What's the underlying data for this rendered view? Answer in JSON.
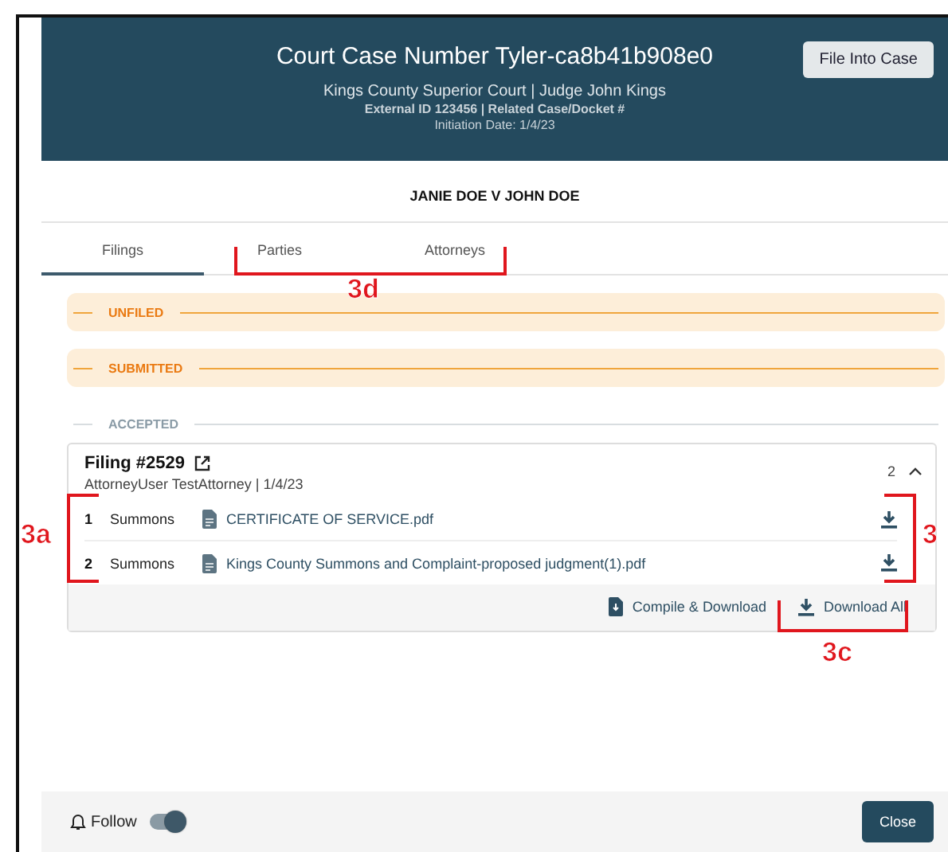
{
  "header": {
    "title": "Court Case Number Tyler-ca8b41b908e0",
    "court_line": "Kings County Superior Court | Judge John Kings",
    "ids_line": "External ID 123456 | Related Case/Docket #",
    "initiation": "Initiation Date: 1/4/23",
    "action": "File Into Case"
  },
  "case_name": "JANIE DOE V JOHN DOE",
  "tabs": [
    {
      "label": "Filings",
      "selected": true
    },
    {
      "label": "Parties",
      "selected": false
    },
    {
      "label": "Attorneys",
      "selected": false
    }
  ],
  "status_groups": [
    {
      "label": "UNFILED",
      "kind": "pending"
    },
    {
      "label": "SUBMITTED",
      "kind": "pending"
    },
    {
      "label": "ACCEPTED",
      "kind": "done"
    }
  ],
  "filing": {
    "title": "Filing #2529",
    "meta": "AttorneyUser TestAttorney | 1/4/23",
    "count": "2",
    "expanded": true,
    "documents": [
      {
        "number": "1",
        "type": "Summons",
        "file": "CERTIFICATE OF SERVICE.pdf"
      },
      {
        "number": "2",
        "type": "Summons",
        "file": "Kings County Summons and Complaint-proposed judgment(1).pdf"
      }
    ],
    "actions": [
      {
        "label": "Compile & Download",
        "kind": "compile"
      },
      {
        "label": "Download All",
        "kind": "download"
      }
    ]
  },
  "footer": {
    "follow_label": "Follow",
    "follow_on": true,
    "close": "Close"
  },
  "annotations": [
    {
      "label": "3d"
    },
    {
      "label": "3a"
    },
    {
      "label": "3"
    },
    {
      "label": "3c"
    }
  ]
}
